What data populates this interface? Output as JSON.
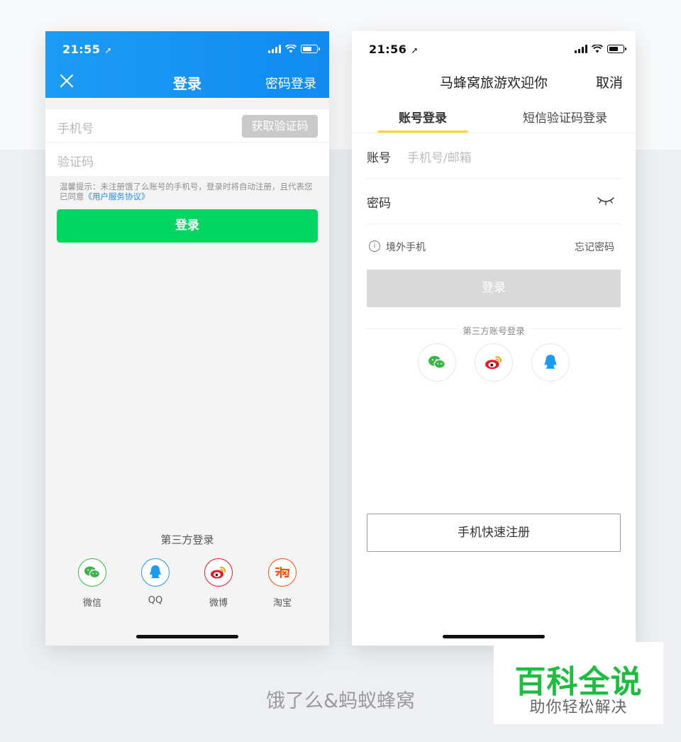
{
  "left_phone": {
    "status_time": "21:55",
    "header": {
      "title": "登录",
      "right_action": "密码登录"
    },
    "phone_placeholder": "手机号",
    "get_code_label": "获取验证码",
    "code_placeholder": "验证码",
    "tip_text": "温馨提示：未注册饿了么账号的手机号，登录时将自动注册，且代表您已同意",
    "tip_link": "《用户服务协议》",
    "login_label": "登录",
    "third_title": "第三方登录",
    "socials": [
      {
        "label": "微信",
        "icon": "wechat-icon",
        "color": "#3bb54a"
      },
      {
        "label": "QQ",
        "icon": "qq-icon",
        "color": "#1a9bf0"
      },
      {
        "label": "微博",
        "icon": "weibo-icon",
        "color": "#e6162d"
      },
      {
        "label": "淘宝",
        "icon": "taobao-icon",
        "color": "#ff5000"
      }
    ],
    "header_color": "#1d9cf5",
    "login_color": "#00d562"
  },
  "right_phone": {
    "status_time": "21:56",
    "title": "马蜂窝旅游欢迎你",
    "cancel_label": "取消",
    "tabs": [
      {
        "label": "账号登录",
        "active": true
      },
      {
        "label": "短信验证码登录",
        "active": false
      }
    ],
    "account_label": "账号",
    "account_placeholder": "手机号/邮箱",
    "password_label": "密码",
    "overseas_label": "境外手机",
    "forgot_label": "忘记密码",
    "login_label": "登录",
    "third_title": "第三方账号登录",
    "socials": [
      "wechat-icon",
      "weibo-icon",
      "qq-icon"
    ],
    "register_label": "手机快速注册",
    "tab_underline_color": "#ffd33c"
  },
  "caption": "饿了么&蚂蚁蜂窝",
  "watermark": {
    "main": "百科全说",
    "sub": "助你轻松解决"
  }
}
